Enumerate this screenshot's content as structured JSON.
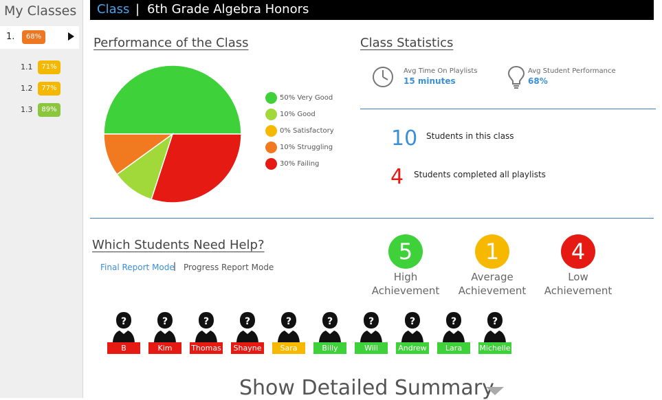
{
  "sidebar": {
    "title": "My Classes",
    "active_class": {
      "number": "1.",
      "percent": "68%",
      "color": "#ee7722"
    },
    "subitems": [
      {
        "number": "1.1",
        "percent": "71%",
        "color": "#f5b800"
      },
      {
        "number": "1.2",
        "percent": "77%",
        "color": "#f5b800"
      },
      {
        "number": "1.3",
        "percent": "89%",
        "color": "#8cc63f"
      }
    ]
  },
  "header": {
    "breadcrumb": "Class",
    "separator": "|",
    "class_name": "6th Grade Algebra Honors"
  },
  "performance": {
    "title": "Performance of the Class",
    "legend": [
      {
        "label": "50% Very Good",
        "color": "#3fd13a"
      },
      {
        "label": "10% Good",
        "color": "#a2d93a"
      },
      {
        "label": "0% Satisfactory",
        "color": "#f7b900"
      },
      {
        "label": "10% Struggling",
        "color": "#f17a20"
      },
      {
        "label": "30% Failing",
        "color": "#e51b13"
      }
    ]
  },
  "chart_data": {
    "type": "pie",
    "categories": [
      "Very Good",
      "Good",
      "Satisfactory",
      "Struggling",
      "Failing"
    ],
    "values": [
      50,
      10,
      0,
      10,
      30
    ],
    "colors": [
      "#3fd13a",
      "#a2d93a",
      "#f7b900",
      "#f17a20",
      "#e51b13"
    ],
    "title": "Performance of the Class"
  },
  "statistics": {
    "title": "Class Statistics",
    "avg_time_label": "Avg Time On Playlists",
    "avg_time_value": "15 minutes",
    "avg_perf_label": "Avg Student Performance",
    "avg_perf_value": "68%",
    "students_count": "10",
    "students_label": "Students in this class",
    "completed_count": "4",
    "completed_label": "Students completed all playlists"
  },
  "help": {
    "title": "Which Students Need Help?",
    "mode_final": "Final Report Mode",
    "mode_separator": "|",
    "mode_progress": "Progress Report Mode"
  },
  "achievement": [
    {
      "count": "5",
      "line1": "High",
      "line2": "Achievement",
      "color": "#3fd13a"
    },
    {
      "count": "1",
      "line1": "Average",
      "line2": "Achievement",
      "color": "#f7b900"
    },
    {
      "count": "4",
      "line1": "Low",
      "line2": "Achievement",
      "color": "#e51b13"
    }
  ],
  "students": [
    {
      "name": "B",
      "color": "#e51b13"
    },
    {
      "name": "Kim",
      "color": "#e51b13"
    },
    {
      "name": "Thomas",
      "color": "#e51b13"
    },
    {
      "name": "Shayne",
      "color": "#e51b13"
    },
    {
      "name": "Sara",
      "color": "#f7b900"
    },
    {
      "name": "Billy",
      "color": "#3fd13a"
    },
    {
      "name": "Will",
      "color": "#3fd13a"
    },
    {
      "name": "Andrew",
      "color": "#3fd13a"
    },
    {
      "name": "Lara",
      "color": "#3fd13a"
    },
    {
      "name": "Michelle",
      "color": "#3fd13a"
    }
  ],
  "summary": {
    "label": "Show Detailed Summary"
  }
}
